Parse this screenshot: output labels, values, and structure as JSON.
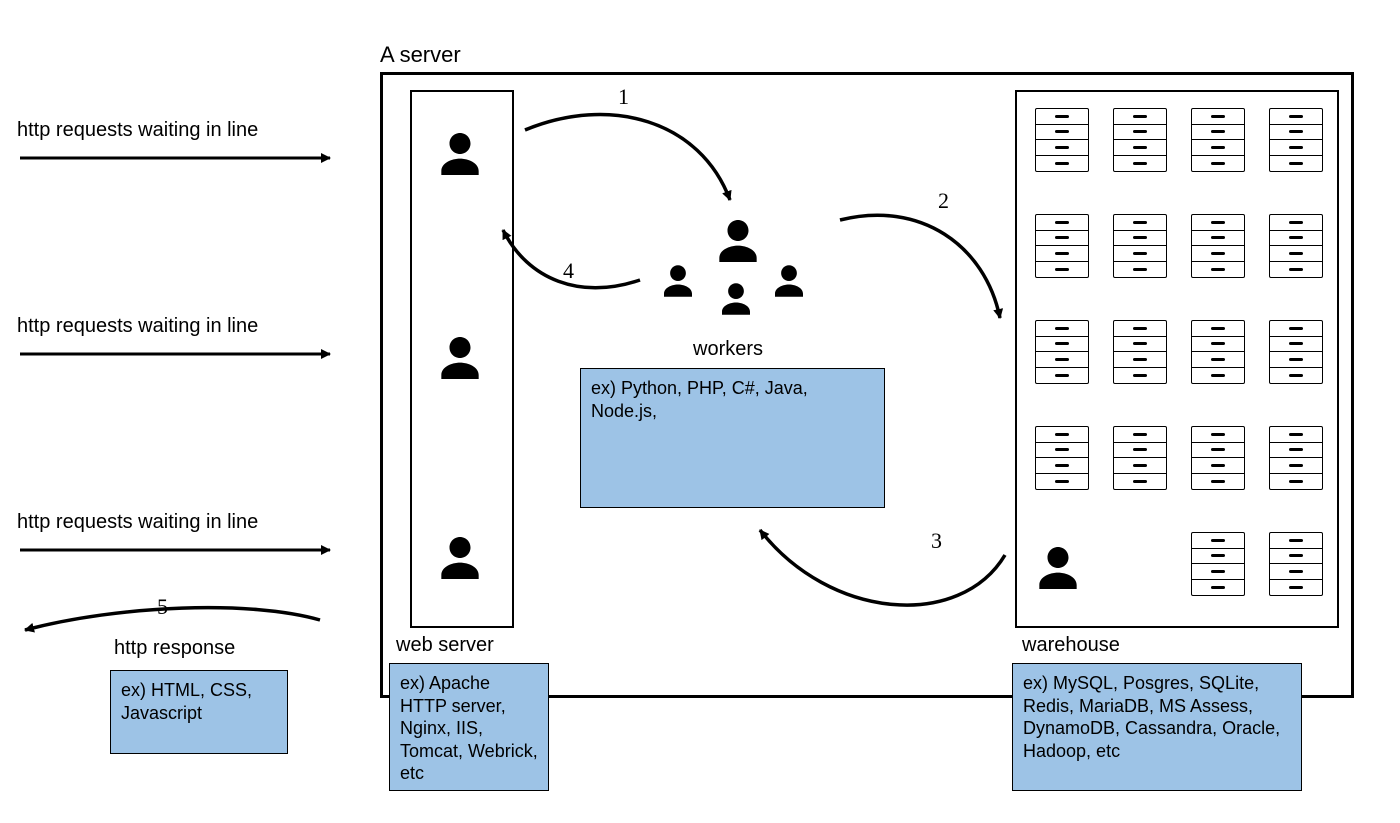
{
  "title": "A server",
  "requests_label": "http requests waiting in line",
  "response_label": "http response",
  "flow_numbers": [
    "1",
    "2",
    "3",
    "4",
    "5"
  ],
  "sections": {
    "web_server": {
      "name": "web server",
      "examples": "ex) Apache HTTP server, Nginx, IIS, Tomcat, Webrick, etc"
    },
    "workers": {
      "name": "workers",
      "examples": "ex) Python, PHP, C#, Java, Node.js,"
    },
    "warehouse": {
      "name": "warehouse",
      "examples": "ex) MySQL, Posgres, SQLite, Redis, MariaDB, MS Assess, DynamoDB, Cassandra, Oracle, Hadoop, etc"
    },
    "http_response": {
      "examples": "ex) HTML, CSS, Javascript"
    }
  }
}
